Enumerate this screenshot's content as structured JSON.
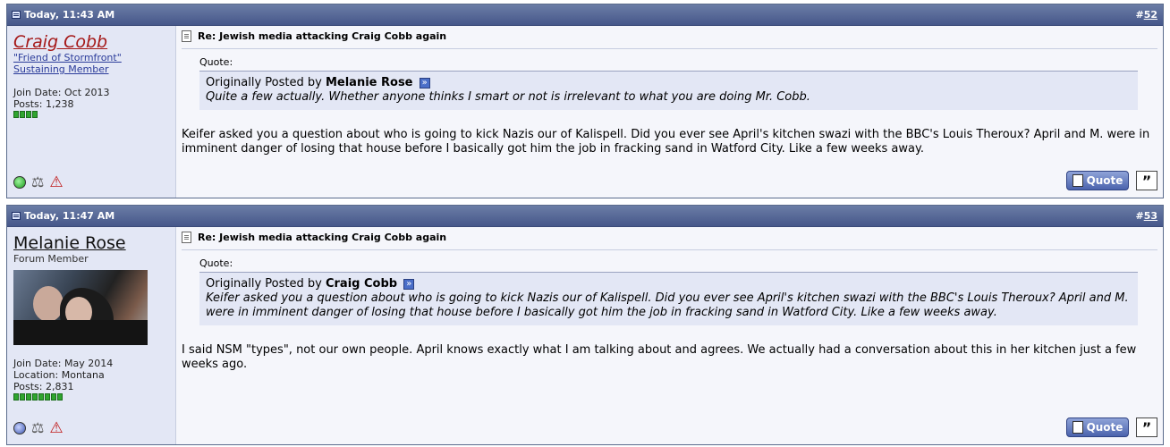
{
  "posts": [
    {
      "timestamp": "Today, 11:43 AM",
      "post_number_prefix": "#",
      "post_number": "52",
      "user": {
        "name": "Craig Cobb",
        "title_line1": "\"Friend of Stormfront\"",
        "title_line2": "Sustaining Member",
        "join_date": "Join Date: Oct 2013",
        "posts": "Posts: 1,238",
        "rep_count": 4,
        "online": true
      },
      "title": "Re: Jewish media attacking Craig Cobb again",
      "quote": {
        "label": "Quote:",
        "by_prefix": "Originally Posted by ",
        "author": "Melanie Rose",
        "text": "Quite a few actually. Whether anyone thinks I smart or not is irrelevant to what you are doing Mr. Cobb."
      },
      "message": "Keifer asked you a question about who is going to kick Nazis our of Kalispell. Did you ever see April's kitchen swazi with the BBC's Louis Theroux? April and M. were in imminent danger of losing that house before I basically got him the job in fracking sand in Watford City. Like a few weeks away.",
      "quote_button": "Quote",
      "multiquote_button": "”"
    },
    {
      "timestamp": "Today, 11:47 AM",
      "post_number_prefix": "#",
      "post_number": "53",
      "user": {
        "name": "Melanie Rose",
        "title_line1": "Forum Member",
        "join_date": "Join Date: May 2014",
        "location": "Location: Montana",
        "posts": "Posts: 2,831",
        "rep_count": 8,
        "online": false
      },
      "title": "Re: Jewish media attacking Craig Cobb again",
      "quote": {
        "label": "Quote:",
        "by_prefix": "Originally Posted by ",
        "author": "Craig Cobb",
        "text": "Keifer asked you a question about who is going to kick Nazis our of Kalispell. Did you ever see April's kitchen swazi with the BBC's Louis Theroux? April and M. were in imminent danger of losing that house before I basically got him the job in fracking sand in Watford City. Like a few weeks away."
      },
      "message": "I said NSM \"types\", not our own people. April knows exactly what I am talking about and agrees. We actually had a conversation about this in her kitchen just a few weeks ago.",
      "quote_button": "Quote",
      "multiquote_button": "”"
    }
  ],
  "icons": {
    "post_icon": "post-icon",
    "document": "document-icon",
    "view_post": "view-post-icon",
    "online_status": "online-status-icon",
    "reputation": "scales-icon",
    "report": "warning-triangle-icon",
    "quote": "quote-button",
    "multiquote": "multiquote-icon"
  },
  "colors": {
    "header_bar": "#46578a",
    "user_panel": "#e3e7f5",
    "username_red": "#a51818",
    "rep_green": "#2fa52f"
  }
}
